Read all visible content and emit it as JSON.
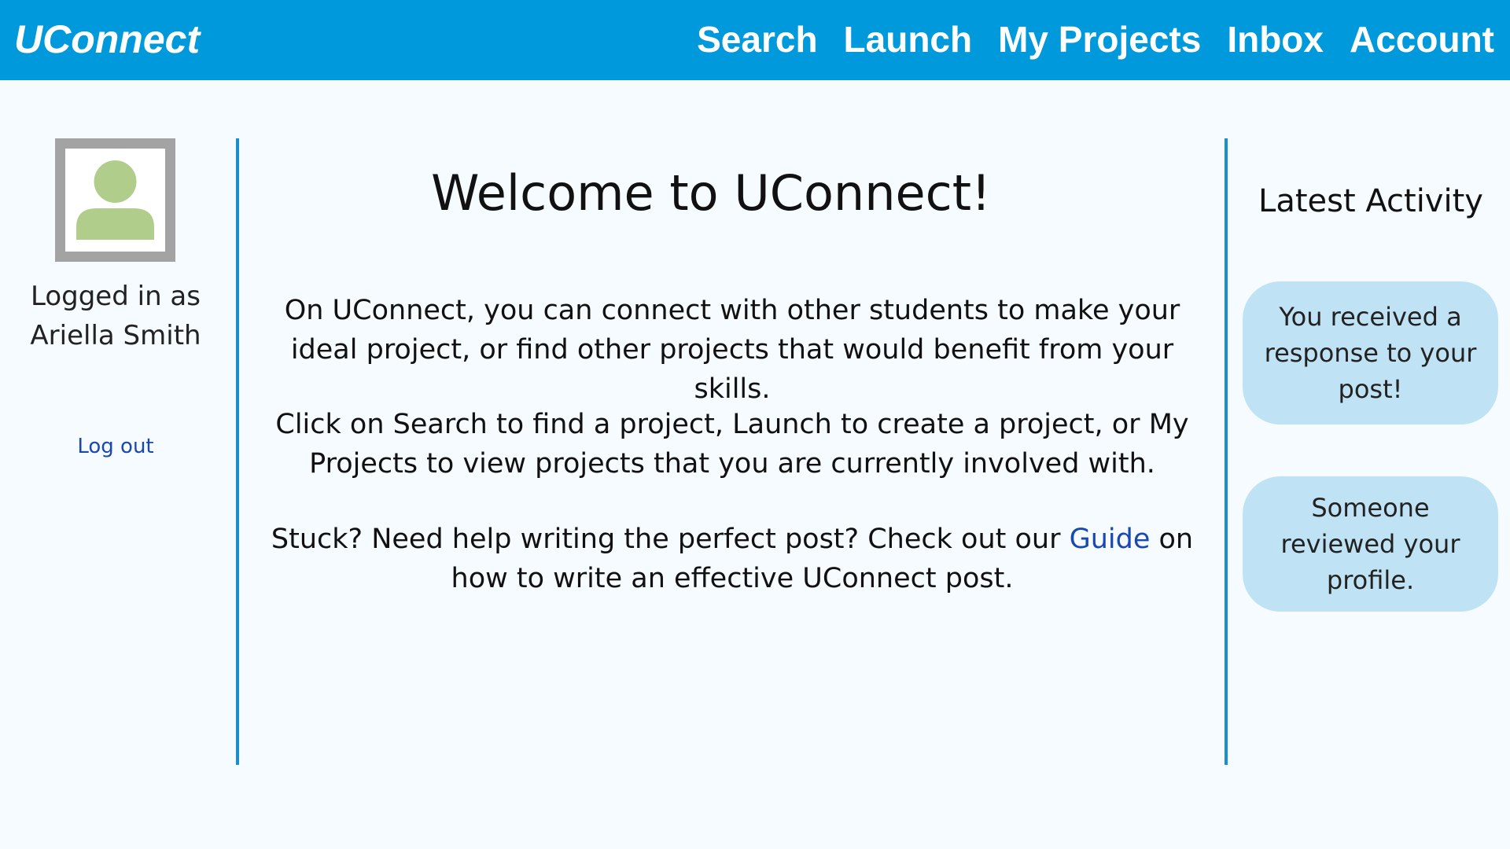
{
  "app": {
    "logo": "UConnect"
  },
  "nav": {
    "items": [
      "Search",
      "Launch",
      "My Projects",
      "Inbox",
      "Account"
    ]
  },
  "user": {
    "logged_in_prefix": "Logged in as",
    "name": "Ariella Smith",
    "logout_label": "Log out"
  },
  "main": {
    "title": "Welcome to UConnect!",
    "paragraph1": "On UConnect, you can connect with other students to make your ideal project, or find other projects that would benefit from your skills.",
    "paragraph2": "Click on Search to find a project, Launch to create a project, or My Projects to view projects that you are currently involved with.",
    "paragraph3_before": "Stuck? Need help writing the perfect post? Check out our ",
    "paragraph3_link": "Guide",
    "paragraph3_after": " on how to write an effective UConnect post."
  },
  "activity": {
    "title": "Latest Activity",
    "items": [
      "You received a response to your post!",
      "Someone reviewed your profile."
    ]
  },
  "colors": {
    "topbar": "#0099db",
    "background": "#f5fbfe",
    "divider": "#1a8fd0",
    "link": "#1848b0",
    "bubble": "#bfe3f4",
    "avatar_figure": "#b0cd8c",
    "avatar_frame": "#a3a3a3"
  },
  "icons": {
    "avatar": "user-avatar-icon"
  }
}
